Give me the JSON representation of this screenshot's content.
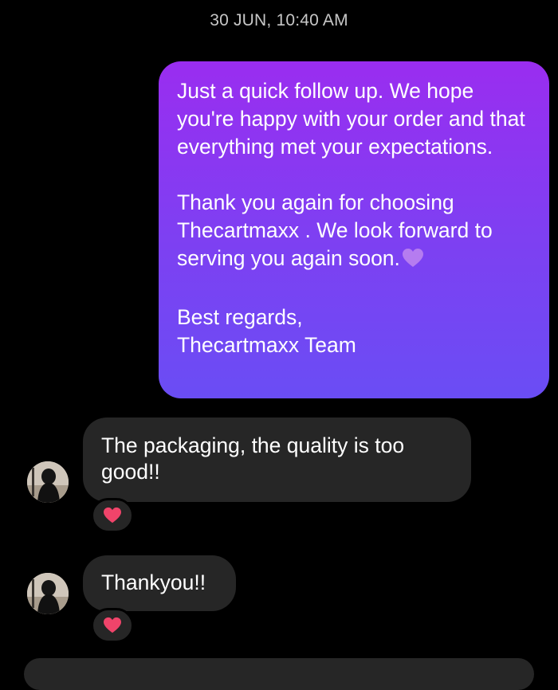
{
  "thread": {
    "timestamp": "30 JUN, 10:40 AM"
  },
  "sent_message": {
    "paragraphs": [
      "Just a quick follow up. We hope you're happy with your order and that everything met your expectations.",
      "Thank you again for choosing Thecartmaxx . We look forward to serving you again soon.",
      "Best regards,\nThecartmaxx Team"
    ],
    "emoji": "purple-heart",
    "bubble_gradient": [
      "#9a2df0",
      "#6a4df4"
    ]
  },
  "received_messages": [
    {
      "text": "The packaging, the quality is too good!!",
      "reaction": "red-heart"
    },
    {
      "text": "Thankyou!!",
      "reaction": "red-heart"
    }
  ],
  "colors": {
    "background": "#000000",
    "received_bubble": "#262626",
    "timestamp_text": "#c7c7c7",
    "reaction_heart": "#f0446a"
  }
}
